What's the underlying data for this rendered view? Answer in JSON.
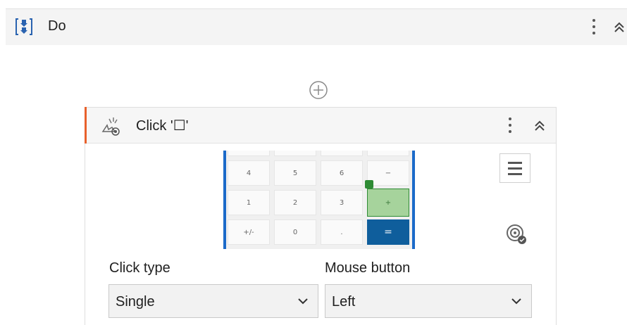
{
  "do_block": {
    "title": "Do",
    "icon": "sequence-icon"
  },
  "click_activity": {
    "title": "Click '☐'",
    "icon": "click-activity-icon",
    "accent_color": "#e8612c"
  },
  "preview": {
    "keys": [
      [
        "",
        "",
        "",
        ""
      ],
      [
        "4",
        "5",
        "6",
        "−"
      ],
      [
        "1",
        "2",
        "3",
        "+"
      ],
      [
        "+/-",
        "0",
        ".",
        "="
      ]
    ],
    "selected_key": "+",
    "accent_blue": "#1b6ac9",
    "selected_green": "#a6d39c"
  },
  "fields": {
    "click_type": {
      "label": "Click type",
      "value": "Single"
    },
    "mouse_button": {
      "label": "Mouse button",
      "value": "Left"
    }
  }
}
